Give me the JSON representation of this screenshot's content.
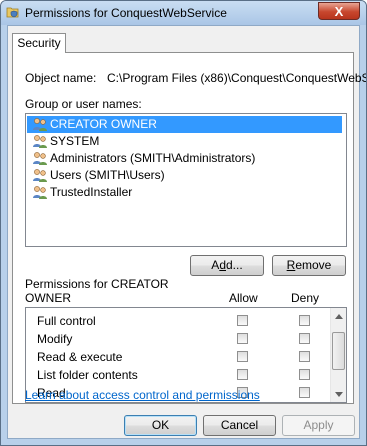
{
  "window": {
    "title": "Permissions for ConquestWebService",
    "close_label": "X"
  },
  "tabs": [
    {
      "label": "Security"
    }
  ],
  "object": {
    "label": "Object name:",
    "value": "C:\\Program Files (x86)\\Conquest\\ConquestWebSe"
  },
  "groups": {
    "label": "Group or user names:",
    "items": [
      {
        "name": "CREATOR OWNER",
        "selected": true,
        "icon": "users-icon"
      },
      {
        "name": "SYSTEM",
        "selected": false,
        "icon": "users-icon"
      },
      {
        "name": "Administrators (SMITH\\Administrators)",
        "selected": false,
        "icon": "users-icon"
      },
      {
        "name": "Users (SMITH\\Users)",
        "selected": false,
        "icon": "users-icon"
      },
      {
        "name": "TrustedInstaller",
        "selected": false,
        "icon": "users-icon"
      }
    ]
  },
  "buttons": {
    "add": "Add...",
    "remove": "Remove",
    "ok": "OK",
    "cancel": "Cancel",
    "apply": "Apply"
  },
  "permissions": {
    "label_line1": "Permissions for CREATOR",
    "label_line2": "OWNER",
    "allow_header": "Allow",
    "deny_header": "Deny",
    "items": [
      {
        "name": "Full control",
        "allow": false,
        "deny": false
      },
      {
        "name": "Modify",
        "allow": false,
        "deny": false
      },
      {
        "name": "Read & execute",
        "allow": false,
        "deny": false
      },
      {
        "name": "List folder contents",
        "allow": false,
        "deny": false
      },
      {
        "name": "Read",
        "allow": false,
        "deny": false
      }
    ]
  },
  "link": "Learn about access control and permissions",
  "colors": {
    "selection": "#3399ff",
    "link": "#0066cc",
    "close_button": "#c7472e"
  }
}
